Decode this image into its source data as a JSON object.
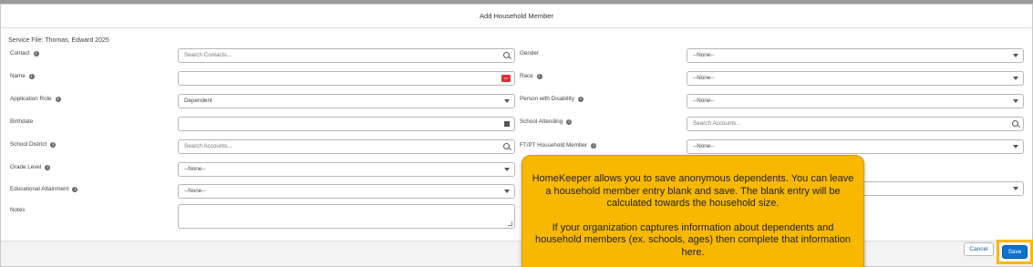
{
  "modal": {
    "title": "Add Household Member",
    "service_file": "Service File: Thomas, Edward 2025"
  },
  "left_fields": [
    {
      "label": "Contact",
      "info": true,
      "value": "Search Contacts...",
      "kind": "lookup",
      "placeholder": true
    },
    {
      "label": "Name",
      "info": true,
      "value": "",
      "kind": "name"
    },
    {
      "label": "Application Role",
      "info": true,
      "value": "Dependent",
      "kind": "select"
    },
    {
      "label": "Birthdate",
      "info": false,
      "value": "",
      "kind": "date"
    },
    {
      "label": "School District",
      "info": true,
      "value": "Search Accounts...",
      "kind": "lookup",
      "placeholder": true
    },
    {
      "label": "Grade Level",
      "info": true,
      "value": "--None--",
      "kind": "select"
    },
    {
      "label": "Educational Attainment",
      "info": true,
      "value": "--None--",
      "kind": "select"
    },
    {
      "label": "Notes",
      "info": false,
      "value": "",
      "kind": "textarea"
    }
  ],
  "right_fields": [
    {
      "label": "Gender",
      "info": false,
      "value": "--None--",
      "kind": "select"
    },
    {
      "label": "Race",
      "info": true,
      "value": "--None--",
      "kind": "select"
    },
    {
      "label": "Person with Disability",
      "info": true,
      "value": "--None--",
      "kind": "select"
    },
    {
      "label": "School Attending",
      "info": true,
      "value": "Search Accounts...",
      "kind": "lookup",
      "placeholder": true
    },
    {
      "label": "FT/PT Household Member",
      "info": true,
      "value": "--None--",
      "kind": "select"
    }
  ],
  "tooltip": {
    "para1": "HomeKeeper allows you to save anonymous dependents. You can leave a household member entry blank and save. The blank entry will be calculated towards the household size.",
    "para2": "If your organization captures information about dependents and household members (ex. schools, ages) then complete that information here."
  },
  "footer": {
    "cancel_label": "Cancel",
    "save_label": "Save"
  },
  "colors": {
    "tooltip_bg": "#f9b800",
    "primary_button": "#0b72d0",
    "required_marker": "#dd3333"
  },
  "icons": {
    "info": "info-icon",
    "lookup": "search-icon",
    "select": "chevron-down-icon",
    "date": "calendar-icon",
    "name_required": "required-icon"
  }
}
